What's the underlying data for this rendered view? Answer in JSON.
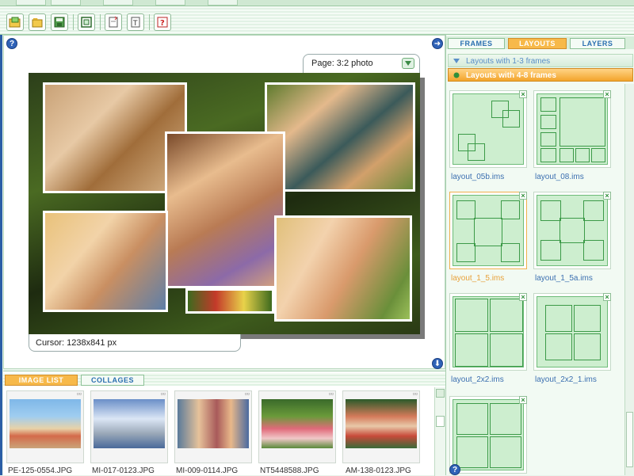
{
  "toolbar": {
    "buttons": [
      "open-icon",
      "open-folder-icon",
      "save-icon",
      "frame-icon",
      "new-page-icon",
      "text-icon",
      "help-icon"
    ]
  },
  "canvas": {
    "page_select_label": "Page: 3:2 photo",
    "cursor_label": "Cursor: 1238x841 px",
    "help_symbol": "?"
  },
  "right_panel": {
    "tabs": [
      "FRAMES",
      "LAYOUTS",
      "LAYERS"
    ],
    "active_tab": "LAYOUTS",
    "group1": "Layouts with 1-3 frames",
    "group2": "Layouts with 4-8 frames",
    "layouts": [
      {
        "name": "layout_05b.ims",
        "selected": false
      },
      {
        "name": "layout_08.ims",
        "selected": false
      },
      {
        "name": "layout_1_5.ims",
        "selected": true
      },
      {
        "name": "layout_1_5a.ims",
        "selected": false
      },
      {
        "name": "layout_2x2.ims",
        "selected": false
      },
      {
        "name": "layout_2x2_1.ims",
        "selected": false
      }
    ]
  },
  "bottom_panel": {
    "tabs": [
      "IMAGE LIST",
      "COLLAGES"
    ],
    "active_tab": "IMAGE LIST",
    "images": [
      {
        "name": "PE-125-0554.JPG"
      },
      {
        "name": "MI-017-0123.JPG"
      },
      {
        "name": "MI-009-0114.JPG"
      },
      {
        "name": "NT5448588.JPG"
      },
      {
        "name": "AM-138-0123.JPG"
      }
    ]
  },
  "colors": {
    "accent_orange": "#f7b94a",
    "panel_green": "#cdeecf",
    "frame_green": "#3c9a48",
    "link_blue": "#3b6fb0"
  }
}
